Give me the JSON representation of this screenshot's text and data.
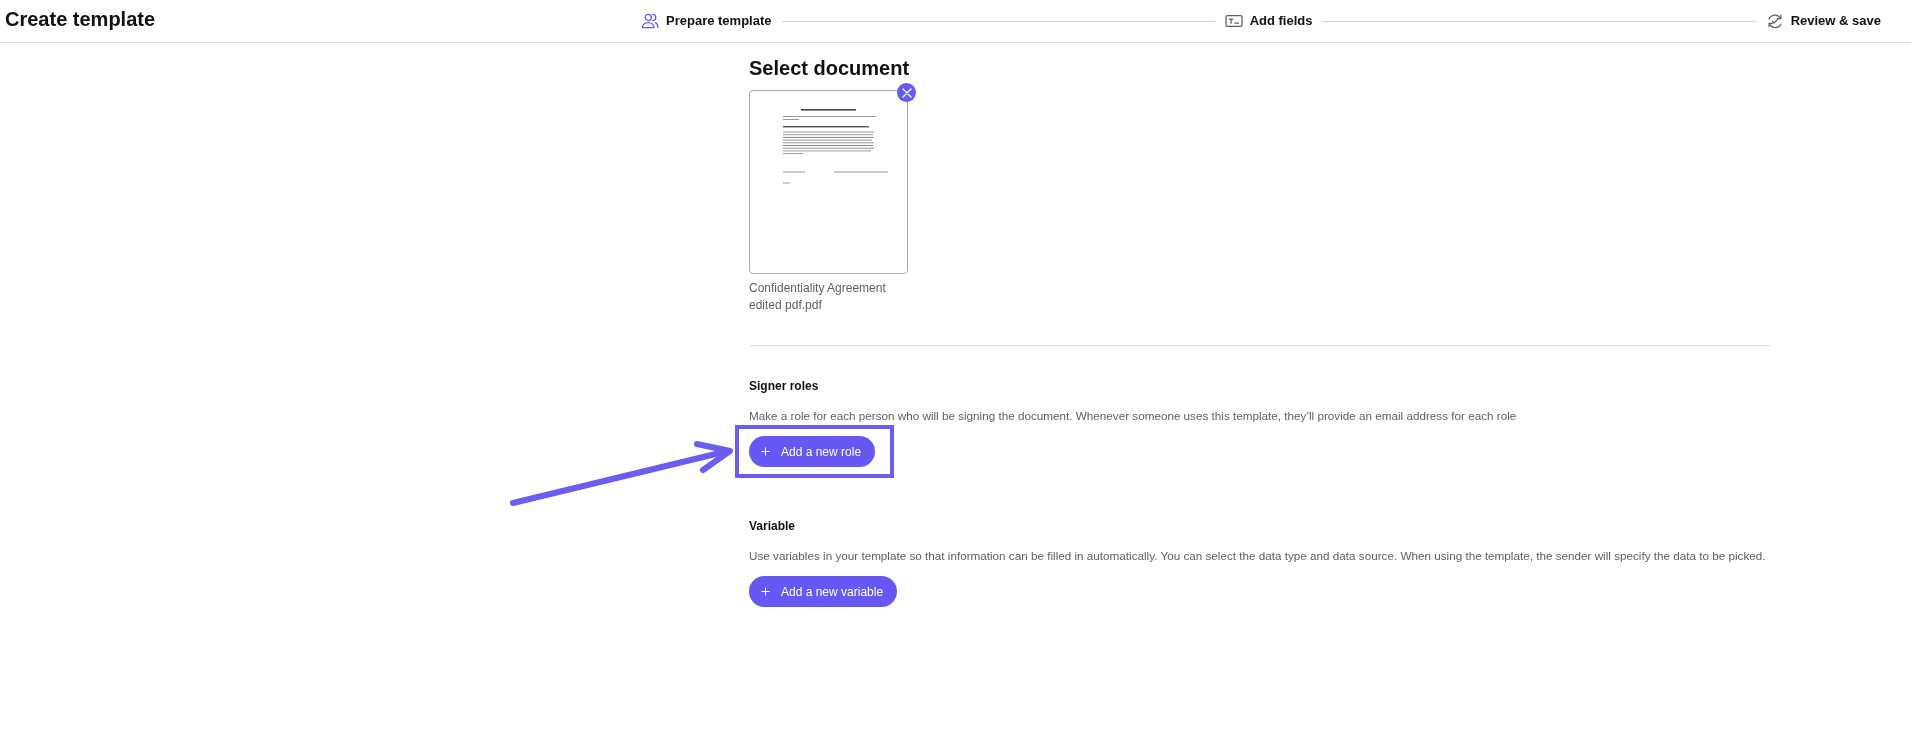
{
  "header": {
    "title": "Create template"
  },
  "steps": [
    {
      "label": "Prepare template",
      "selected": true
    },
    {
      "label": "Add fields",
      "selected": false
    },
    {
      "label": "Review & save",
      "selected": false
    }
  ],
  "document": {
    "heading": "Select document",
    "file_name": "Confidentiality Agreement edited pdf.pdf"
  },
  "sections": [
    {
      "title": "Signer roles",
      "description": "Make a role for each person who will be signing the document. Whenever someone uses this template, they’ll provide an email address for each role",
      "button": {
        "label": "Add a new role",
        "highlighted": true
      }
    },
    {
      "title": "Variable",
      "description": "Use variables in your template so that information can be filled in automatically. You can select the data type and data source. When using the template, the sender will specify the data to be picked.",
      "button": {
        "label": "Add a new variable",
        "highlighted": false
      }
    }
  ]
}
